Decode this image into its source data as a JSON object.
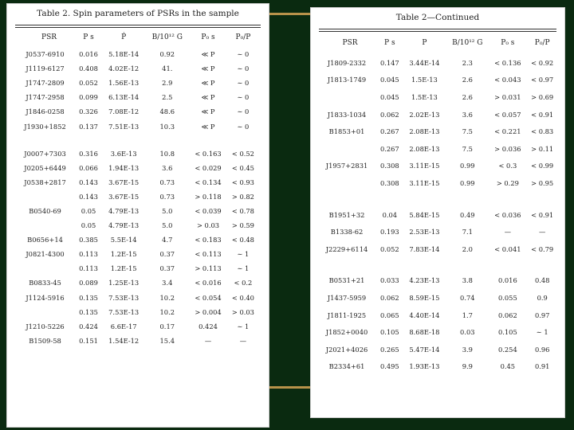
{
  "left_table": {
    "title": "Table 2.   Spin parameters of PSRs in the sample",
    "headers": [
      "PSR",
      "P s",
      "Ṗ",
      "B/10¹² G",
      "P₀ s",
      "P₀/P"
    ],
    "groups": [
      [
        [
          "J0537-6910",
          "0.016",
          "5.18E-14",
          "0.92",
          "≪ P",
          "∼ 0"
        ],
        [
          "J1119-6127",
          "0.408",
          "4.02E-12",
          "41.",
          "≪ P",
          "∼ 0"
        ],
        [
          "J1747-2809",
          "0.052",
          "1.56E-13",
          "2.9",
          "≪ P",
          "∼ 0"
        ],
        [
          "J1747-2958",
          "0.099",
          "6.13E-14",
          "2.5",
          "≪ P",
          "∼ 0"
        ],
        [
          "J1846-0258",
          "0.326",
          "7.08E-12",
          "48.6",
          "≪ P",
          "∼ 0"
        ],
        [
          "J1930+1852",
          "0.137",
          "7.51E-13",
          "10.3",
          "≪ P",
          "∼ 0"
        ]
      ],
      [
        [
          "J0007+7303",
          "0.316",
          "3.6E-13",
          "10.8",
          "< 0.163",
          "< 0.52"
        ],
        [
          "J0205+6449",
          "0.066",
          "1.94E-13",
          "3.6",
          "< 0.029",
          "< 0.45"
        ],
        [
          "J0538+2817",
          "0.143",
          "3.67E-15",
          "0.73",
          "< 0.134",
          "< 0.93"
        ],
        [
          "",
          "0.143",
          "3.67E-15",
          "0.73",
          "> 0.118",
          "> 0.82"
        ],
        [
          "B0540-69",
          "0.05",
          "4.79E-13",
          "5.0",
          "< 0.039",
          "< 0.78"
        ],
        [
          "",
          "0.05",
          "4.79E-13",
          "5.0",
          "> 0.03",
          "> 0.59"
        ],
        [
          "B0656+14",
          "0.385",
          "5.5E-14",
          "4.7",
          "< 0.183",
          "< 0.48"
        ],
        [
          "J0821-4300",
          "0.113",
          "1.2E-15",
          "0.37",
          "< 0.113",
          "∼ 1"
        ],
        [
          "",
          "0.113",
          "1.2E-15",
          "0.37",
          "> 0.113",
          "∼ 1"
        ],
        [
          "B0833-45",
          "0.089",
          "1.25E-13",
          "3.4",
          "< 0.016",
          "< 0.2"
        ],
        [
          "J1124-5916",
          "0.135",
          "7.53E-13",
          "10.2",
          "< 0.054",
          "< 0.40"
        ],
        [
          "",
          "0.135",
          "7.53E-13",
          "10.2",
          "> 0.004",
          "> 0.03"
        ],
        [
          "J1210-5226",
          "0.424",
          "6.6E-17",
          "0.17",
          "0.424",
          "∼ 1"
        ],
        [
          "B1509-58",
          "0.151",
          "1.54E-12",
          "15.4",
          "—",
          "—"
        ]
      ]
    ]
  },
  "right_table": {
    "title": "Table 2—Continued",
    "headers": [
      "PSR",
      "P s",
      "P",
      "B/10¹² G",
      "P₀ s",
      "P₀/P"
    ],
    "groups": [
      [
        [
          "J1809-2332",
          "0.147",
          "3.44E-14",
          "2.3",
          "< 0.136",
          "< 0.92"
        ],
        [
          "J1813-1749",
          "0.045",
          "1.5E-13",
          "2.6",
          "< 0.043",
          "< 0.97"
        ],
        [
          "",
          "0.045",
          "1.5E-13",
          "2.6",
          "> 0.031",
          "> 0.69"
        ],
        [
          "J1833-1034",
          "0.062",
          "2.02E-13",
          "3.6",
          "< 0.057",
          "< 0.91"
        ],
        [
          "B1853+01",
          "0.267",
          "2.08E-13",
          "7.5",
          "< 0.221",
          "< 0.83"
        ],
        [
          "",
          "0.267",
          "2.08E-13",
          "7.5",
          "> 0.036",
          "> 0.11"
        ],
        [
          "J1957+2831",
          "0.308",
          "3.11E-15",
          "0.99",
          "< 0.3",
          "< 0.99"
        ],
        [
          "",
          "0.308",
          "3.11E-15",
          "0.99",
          "> 0.29",
          "> 0.95"
        ]
      ],
      [
        [
          "B1951+32",
          "0.04",
          "5.84E-15",
          "0.49",
          "< 0.036",
          "< 0.91"
        ],
        [
          "B1338-62",
          "0.193",
          "2.53E-13",
          "7.1",
          "—",
          "—"
        ],
        [
          "J2229+6114",
          "0.052",
          "7.83E-14",
          "2.0",
          "< 0.041",
          "< 0.79"
        ]
      ],
      [
        [
          "B0531+21",
          "0.033",
          "4.23E-13",
          "3.8",
          "0.016",
          "0.48"
        ],
        [
          "J1437-5959",
          "0.062",
          "8.59E-15",
          "0.74",
          "0.055",
          "0.9"
        ],
        [
          "J1811-1925",
          "0.065",
          "4.40E-14",
          "1.7",
          "0.062",
          "0.97"
        ],
        [
          "J1852+0040",
          "0.105",
          "8.68E-18",
          "0.03",
          "0.105",
          "∼ 1"
        ],
        [
          "J2021+4026",
          "0.265",
          "5.47E-14",
          "3.9",
          "0.254",
          "0.96"
        ],
        [
          "B2334+61",
          "0.495",
          "1.93E-13",
          "9.9",
          "0.45",
          "0.91"
        ]
      ]
    ]
  }
}
